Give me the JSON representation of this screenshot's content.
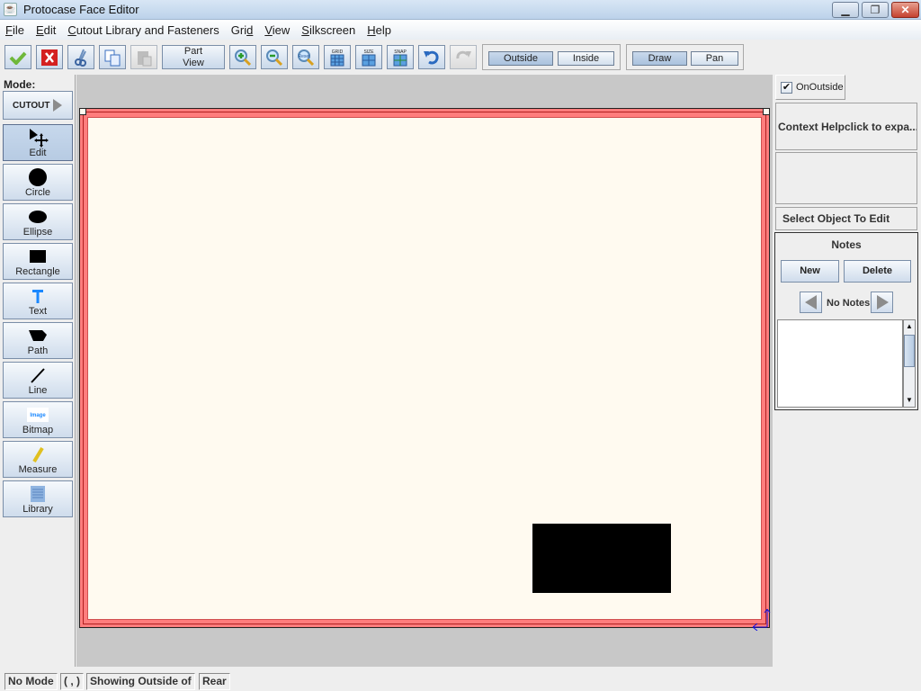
{
  "window": {
    "title": "Protocase Face Editor",
    "app_icon": "java-cup-icon",
    "controls": {
      "minimize": "minimize-icon",
      "maximize": "restore-icon",
      "close": "close-icon"
    }
  },
  "menu": {
    "items": [
      {
        "label": "File",
        "mnemonic": "F"
      },
      {
        "label": "Edit",
        "mnemonic": "E"
      },
      {
        "label": "Cutout Library and Fasteners",
        "mnemonic": "C"
      },
      {
        "label": "Grid",
        "mnemonic": "d"
      },
      {
        "label": "View",
        "mnemonic": "V"
      },
      {
        "label": "Silkscreen",
        "mnemonic": "S"
      },
      {
        "label": "Help",
        "mnemonic": "H"
      }
    ]
  },
  "toolbar": {
    "buttons": [
      {
        "name": "accept",
        "icon": "checkmark-icon",
        "enabled": true
      },
      {
        "name": "cancel",
        "icon": "red-x-icon",
        "enabled": true
      },
      {
        "name": "cut",
        "icon": "scissors-icon",
        "enabled": true
      },
      {
        "name": "copy",
        "icon": "copy-icon",
        "enabled": true
      },
      {
        "name": "paste",
        "icon": "paste-icon",
        "enabled": false
      },
      {
        "name": "part-view",
        "label_line1": "Part",
        "label_line2": "View",
        "enabled": true
      },
      {
        "name": "zoom-in",
        "icon": "zoom-in-icon",
        "enabled": true
      },
      {
        "name": "zoom-out",
        "icon": "zoom-out-icon",
        "enabled": true
      },
      {
        "name": "zoom-reset",
        "icon": "zoom-reset-icon",
        "label": "Reset",
        "enabled": true
      },
      {
        "name": "grid",
        "icon": "grid-icon",
        "label": "GRID",
        "enabled": true
      },
      {
        "name": "size",
        "icon": "grid-size-icon",
        "label": "SIZE",
        "enabled": true
      },
      {
        "name": "snap",
        "icon": "snap-icon",
        "label": "SNAP",
        "enabled": true
      },
      {
        "name": "undo",
        "icon": "undo-icon",
        "enabled": true
      },
      {
        "name": "redo",
        "icon": "redo-icon",
        "enabled": false
      }
    ],
    "side_toggle": {
      "options": [
        "Outside",
        "Inside"
      ],
      "selected": "Outside"
    },
    "mode_toggle": {
      "options": [
        "Draw",
        "Pan"
      ],
      "selected": "Draw"
    }
  },
  "left_panel": {
    "mode_label": "Mode:",
    "cutout_button": "CUTOUT",
    "tools": [
      {
        "label": "Edit",
        "icon": "select-move-icon",
        "active": true
      },
      {
        "label": "Circle",
        "icon": "circle-icon",
        "active": false
      },
      {
        "label": "Ellipse",
        "icon": "ellipse-icon",
        "active": false
      },
      {
        "label": "Rectangle",
        "icon": "rectangle-icon",
        "active": false
      },
      {
        "label": "Text",
        "icon": "text-icon",
        "active": false
      },
      {
        "label": "Path",
        "icon": "path-icon",
        "active": false
      },
      {
        "label": "Line",
        "icon": "line-icon",
        "active": false
      },
      {
        "label": "Bitmap",
        "icon": "image-icon",
        "icon_text": "Image",
        "active": false
      },
      {
        "label": "Measure",
        "icon": "ruler-icon",
        "active": false
      },
      {
        "label": "Library",
        "icon": "library-icon",
        "active": false
      }
    ]
  },
  "canvas": {
    "face_color": "#fffaf0",
    "border_color": "#ff7d7d",
    "cutouts": [
      {
        "shape": "rectangle",
        "fill": "#000000"
      }
    ]
  },
  "right_panel": {
    "on_outside": {
      "label": "OnOutside",
      "checked": true
    },
    "context_help": "Context Helpclick to expa...",
    "select_object": "Select Object To Edit",
    "notes": {
      "title": "Notes",
      "new_label": "New",
      "delete_label": "Delete",
      "status": "No Notes",
      "text": ""
    }
  },
  "status_bar": {
    "mode": "No Mode",
    "coords": "( , )",
    "showing": "Showing Outside of",
    "face": "Rear"
  }
}
